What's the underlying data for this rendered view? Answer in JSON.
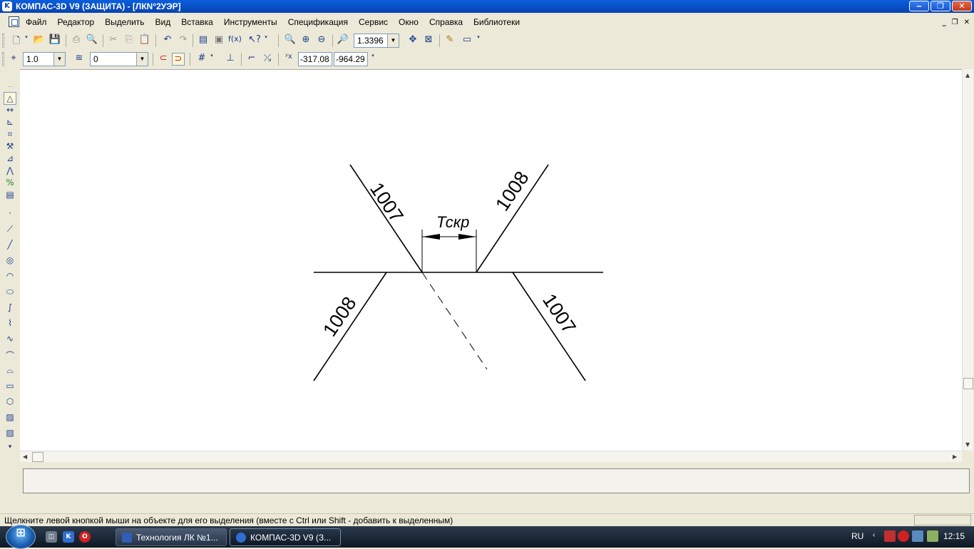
{
  "window": {
    "title": "КОМПАС-3D V9 (ЗАЩИТА) - [ЛКN°2УЭР]"
  },
  "menu": {
    "items": [
      "Файл",
      "Редактор",
      "Выделить",
      "Вид",
      "Вставка",
      "Инструменты",
      "Спецификация",
      "Сервис",
      "Окно",
      "Справка",
      "Библиотеки"
    ]
  },
  "toolbar": {
    "zoom_value": "1.3396",
    "line_step_value": "1.0",
    "layer_value": "0",
    "coord_x": "-317.08",
    "coord_y": "-964.29"
  },
  "drawing": {
    "labels": {
      "upper_left": "1007",
      "upper_right": "1008",
      "lower_left": "1008",
      "lower_right": "1007",
      "dimension": "Тскр"
    }
  },
  "status": {
    "hint": "Щелкните левой кнопкой мыши на объекте для его выделения (вместе с Ctrl или Shift - добавить к выделенным)"
  },
  "taskbar": {
    "tasks": [
      "Технология ЛК №1...",
      "КОМПАС-3D V9 (З..."
    ],
    "language": "RU",
    "clock": "12:15"
  },
  "colors": {
    "titlebar": "#0a5fdc",
    "taskbar": "#1c2838",
    "canvas": "#ffffff",
    "close_button": "#d2492a"
  }
}
